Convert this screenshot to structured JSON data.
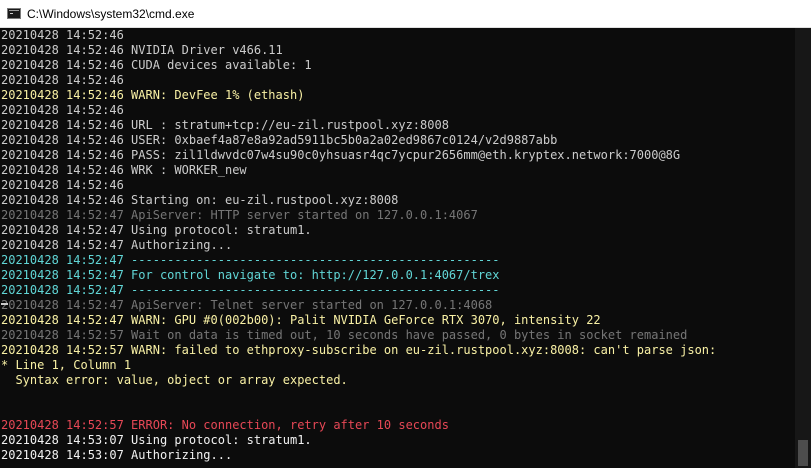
{
  "window": {
    "title": "C:\\Windows\\system32\\cmd.exe"
  },
  "colors": {
    "normal": "#cccccc",
    "warn": "#f9f1a5",
    "info": "#61d6d6",
    "dim": "#767676",
    "error": "#e74856",
    "white": "#f2f2f2"
  },
  "console": {
    "lines": [
      {
        "text": "20210428 14:52:46",
        "color": "normal"
      },
      {
        "text": "20210428 14:52:46 NVIDIA Driver v466.11",
        "color": "normal"
      },
      {
        "text": "20210428 14:52:46 CUDA devices available: 1",
        "color": "normal"
      },
      {
        "text": "20210428 14:52:46",
        "color": "normal"
      },
      {
        "text": "20210428 14:52:46 WARN: DevFee 1% (ethash)",
        "color": "warn"
      },
      {
        "text": "20210428 14:52:46",
        "color": "normal"
      },
      {
        "text": "20210428 14:52:46 URL : stratum+tcp://eu-zil.rustpool.xyz:8008",
        "color": "normal"
      },
      {
        "text": "20210428 14:52:46 USER: 0xbaef4a87e8a92ad5911bc5b0a2a02ed9867c0124/v2d9887abb",
        "color": "normal"
      },
      {
        "text": "20210428 14:52:46 PASS: zil1ldwvdc07w4su90c0yhsuasr4qc7ycpur2656mm@eth.kryptex.network:7000@8G",
        "color": "normal"
      },
      {
        "text": "20210428 14:52:46 WRK : WORKER_new",
        "color": "normal"
      },
      {
        "text": "20210428 14:52:46",
        "color": "normal"
      },
      {
        "text": "20210428 14:52:46 Starting on: eu-zil.rustpool.xyz:8008",
        "color": "normal"
      },
      {
        "text": "20210428 14:52:47 ApiServer: HTTP server started on 127.0.0.1:4067",
        "color": "dim"
      },
      {
        "text": "20210428 14:52:47 Using protocol: stratum1.",
        "color": "normal"
      },
      {
        "text": "20210428 14:52:47 Authorizing...",
        "color": "normal"
      },
      {
        "text": "20210428 14:52:47 ---------------------------------------------------",
        "color": "info"
      },
      {
        "text": "20210428 14:52:47 For control navigate to: http://127.0.0.1:4067/trex",
        "color": "info"
      },
      {
        "text": "20210428 14:52:47 ---------------------------------------------------",
        "color": "info"
      },
      {
        "text": "20210428 14:52:47 ApiServer: Telnet server started on 127.0.0.1:4068",
        "color": "dim"
      },
      {
        "text": "20210428 14:52:47 WARN: GPU #0(002b00): Palit NVIDIA GeForce RTX 3070, intensity 22",
        "color": "warn"
      },
      {
        "text": "20210428 14:52:57 Wait on data is timed out, 10 seconds have passed, 0 bytes in socket remained",
        "color": "dim"
      },
      {
        "text": "20210428 14:52:57 WARN: failed to ethproxy-subscribe on eu-zil.rustpool.xyz:8008: can't parse json:",
        "color": "warn"
      },
      {
        "text": "* Line 1, Column 1",
        "color": "warn"
      },
      {
        "text": "  Syntax error: value, object or array expected.",
        "color": "warn"
      },
      {
        "text": "",
        "color": "normal"
      },
      {
        "text": "",
        "color": "normal"
      },
      {
        "text": "20210428 14:52:57 ERROR: No connection, retry after 10 seconds",
        "color": "error"
      },
      {
        "text": "20210428 14:53:07 Using protocol: stratum1.",
        "color": "white"
      },
      {
        "text": "20210428 14:53:07 Authorizing...",
        "color": "white"
      }
    ]
  }
}
